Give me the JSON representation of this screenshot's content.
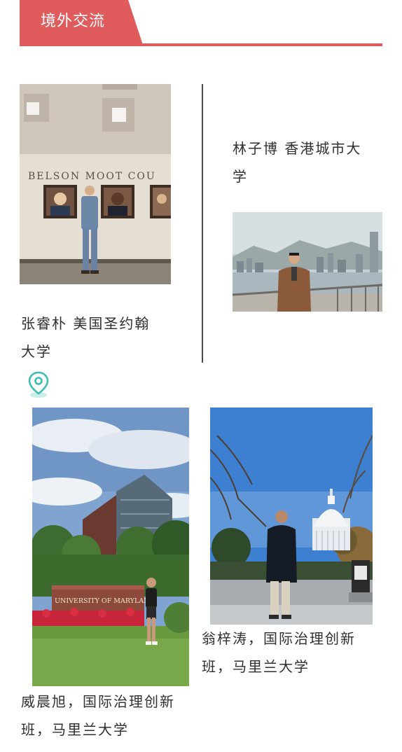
{
  "section": {
    "title": "境外交流",
    "accent_color": "#e05c5c"
  },
  "students": [
    {
      "caption_line1": "张睿朴 美国圣约翰",
      "caption_line2": "大学",
      "sign_text": "BELSON MOOT COU"
    },
    {
      "caption_line1": "林子博 香港城市大",
      "caption_line2": "学"
    },
    {
      "caption_line1": "威晨旭，国际治理创新",
      "caption_line2": "班，马里兰大学",
      "sign_text": "UNIVERSITY OF MARYLAND"
    },
    {
      "caption_line1": "翁梓涛，国际治理创新",
      "caption_line2": "班，马里兰大学"
    }
  ],
  "icons": {
    "location": "map-pin-icon",
    "location_color": "#3dbcb0"
  }
}
